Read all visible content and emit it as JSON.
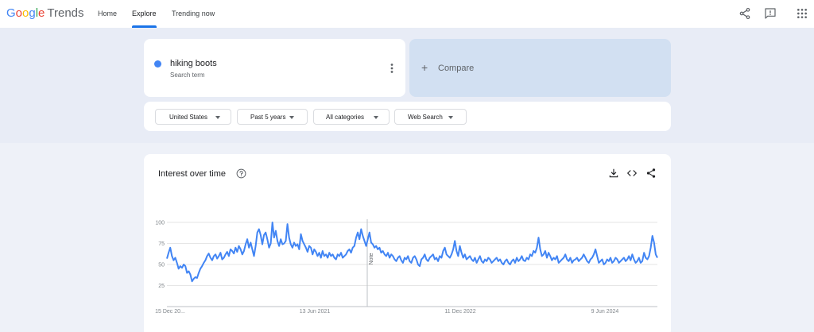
{
  "header": {
    "logo_google": [
      "G",
      "o",
      "o",
      "g",
      "l",
      "e"
    ],
    "logo_product": "Trends",
    "nav": {
      "home": "Home",
      "explore": "Explore",
      "trending": "Trending now"
    },
    "icons": [
      "share-icon",
      "feedback-icon",
      "apps-grid-icon"
    ]
  },
  "search_term": {
    "name": "hiking boots",
    "type": "Search term",
    "color": "#4285f4"
  },
  "compare": {
    "plus": "+",
    "label": "Compare"
  },
  "filters": {
    "region": "United States",
    "time_range": "Past 5 years",
    "category": "All categories",
    "search_type": "Web Search"
  },
  "chart_card": {
    "title": "Interest over time",
    "icons": [
      "help-icon",
      "download-icon",
      "embed-icon",
      "share-icon"
    ]
  },
  "chart_data": {
    "type": "line",
    "title": "Interest over time",
    "xlabel": "",
    "ylabel": "",
    "ylim": [
      0,
      100
    ],
    "yticks": [
      25,
      50,
      75,
      100
    ],
    "x_tick_labels": [
      "15 Dec 20...",
      "13 Jun 2021",
      "11 Dec 2022",
      "9 Jun 2024"
    ],
    "annotation": "Note",
    "color": "#4285f4",
    "grid": true,
    "series": [
      {
        "values": [
          57,
          64,
          70,
          60,
          55,
          58,
          52,
          45,
          48,
          46,
          50,
          48,
          40,
          42,
          38,
          30,
          33,
          35,
          34,
          40,
          45,
          48,
          52,
          55,
          60,
          63,
          58,
          55,
          60,
          62,
          57,
          60,
          64,
          56,
          58,
          62,
          65,
          60,
          68,
          66,
          63,
          70,
          65,
          72,
          68,
          62,
          66,
          74,
          80,
          70,
          76,
          68,
          60,
          72,
          88,
          92,
          85,
          74,
          85,
          88,
          80,
          70,
          75,
          100,
          82,
          90,
          78,
          72,
          80,
          74,
          75,
          78,
          98,
          82,
          74,
          70,
          76,
          72,
          74,
          68,
          86,
          78,
          74,
          70,
          65,
          72,
          70,
          62,
          68,
          65,
          60,
          64,
          58,
          66,
          60,
          62,
          58,
          64,
          60,
          62,
          58,
          56,
          62,
          60,
          64,
          58,
          60,
          62,
          66,
          68,
          64,
          70,
          72,
          82,
          88,
          80,
          92,
          84,
          78,
          72,
          80,
          88,
          76,
          74,
          70,
          72,
          68,
          70,
          64,
          66,
          62,
          60,
          64,
          58,
          62,
          60,
          56,
          54,
          58,
          60,
          55,
          52,
          58,
          56,
          60,
          54,
          52,
          58,
          60,
          56,
          50,
          48,
          56,
          58,
          62,
          56,
          54,
          58,
          60,
          62,
          56,
          58,
          54,
          60,
          58,
          66,
          70,
          62,
          60,
          58,
          62,
          68,
          78,
          66,
          60,
          72,
          64,
          58,
          62,
          56,
          58,
          60,
          56,
          54,
          58,
          52,
          56,
          60,
          54,
          52,
          56,
          54,
          58,
          56,
          52,
          54,
          56,
          58,
          54,
          56,
          52,
          50,
          54,
          56,
          52,
          50,
          54,
          56,
          52,
          58,
          54,
          56,
          60,
          55,
          54,
          58,
          56,
          62,
          60,
          66,
          64,
          70,
          82,
          68,
          60,
          62,
          66,
          58,
          64,
          60,
          55,
          58,
          56,
          60,
          52,
          54,
          56,
          58,
          62,
          56,
          54,
          58,
          52,
          55,
          56,
          58,
          54,
          56,
          58,
          62,
          58,
          54,
          52,
          56,
          58,
          62,
          68,
          60,
          52,
          54,
          56,
          50,
          52,
          56,
          54,
          58,
          52,
          54,
          58,
          56,
          52,
          54,
          56,
          58,
          54,
          56,
          60,
          55,
          62,
          56,
          52,
          54,
          58,
          52,
          54,
          64,
          58,
          56,
          60,
          70,
          84,
          76,
          62,
          58
        ]
      }
    ]
  }
}
